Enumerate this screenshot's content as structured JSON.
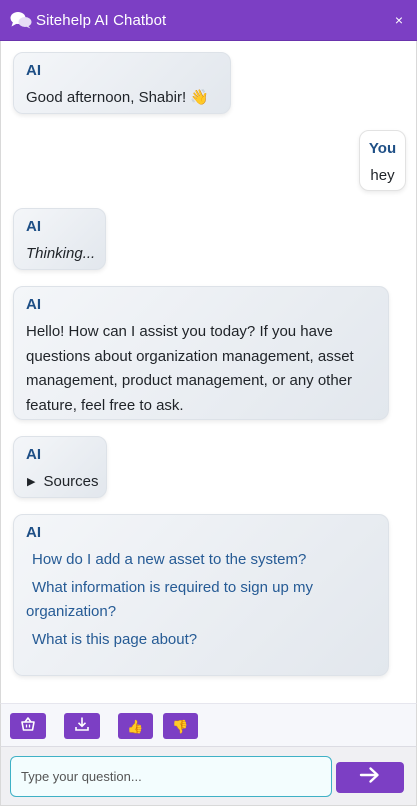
{
  "header": {
    "title": "Sitehelp AI Chatbot",
    "close_label": "×"
  },
  "messages": [
    {
      "sender": "AI",
      "text": "Good afternoon, Shabir! 👋"
    },
    {
      "sender": "You",
      "text": "hey"
    },
    {
      "sender": "AI",
      "text": "Thinking..."
    },
    {
      "sender": "AI",
      "text": "Hello! How can I assist you today? If you have questions about organization management, asset management, product management, or any other feature, feel free to ask."
    },
    {
      "sender": "AI",
      "sources_label": "Sources"
    },
    {
      "sender": "AI",
      "suggestions": [
        "How do I add a new asset to the system?",
        "What information is required to sign up my organization?",
        "What is this page about?"
      ]
    }
  ],
  "toolbar": {
    "buttons": [
      {
        "icon": "basket-icon"
      },
      {
        "icon": "download-icon"
      },
      {
        "icon": "thumbs-up-icon",
        "glyph": "👍"
      },
      {
        "icon": "thumbs-down-icon",
        "glyph": "👎"
      }
    ]
  },
  "input": {
    "placeholder": "Type your question...",
    "value": ""
  },
  "send": {
    "icon": "arrow-right-icon"
  },
  "colors": {
    "brand": "#7c3fc4",
    "sender": "#1e4f86",
    "link": "#265b95",
    "input_border": "#3fb1c6"
  }
}
